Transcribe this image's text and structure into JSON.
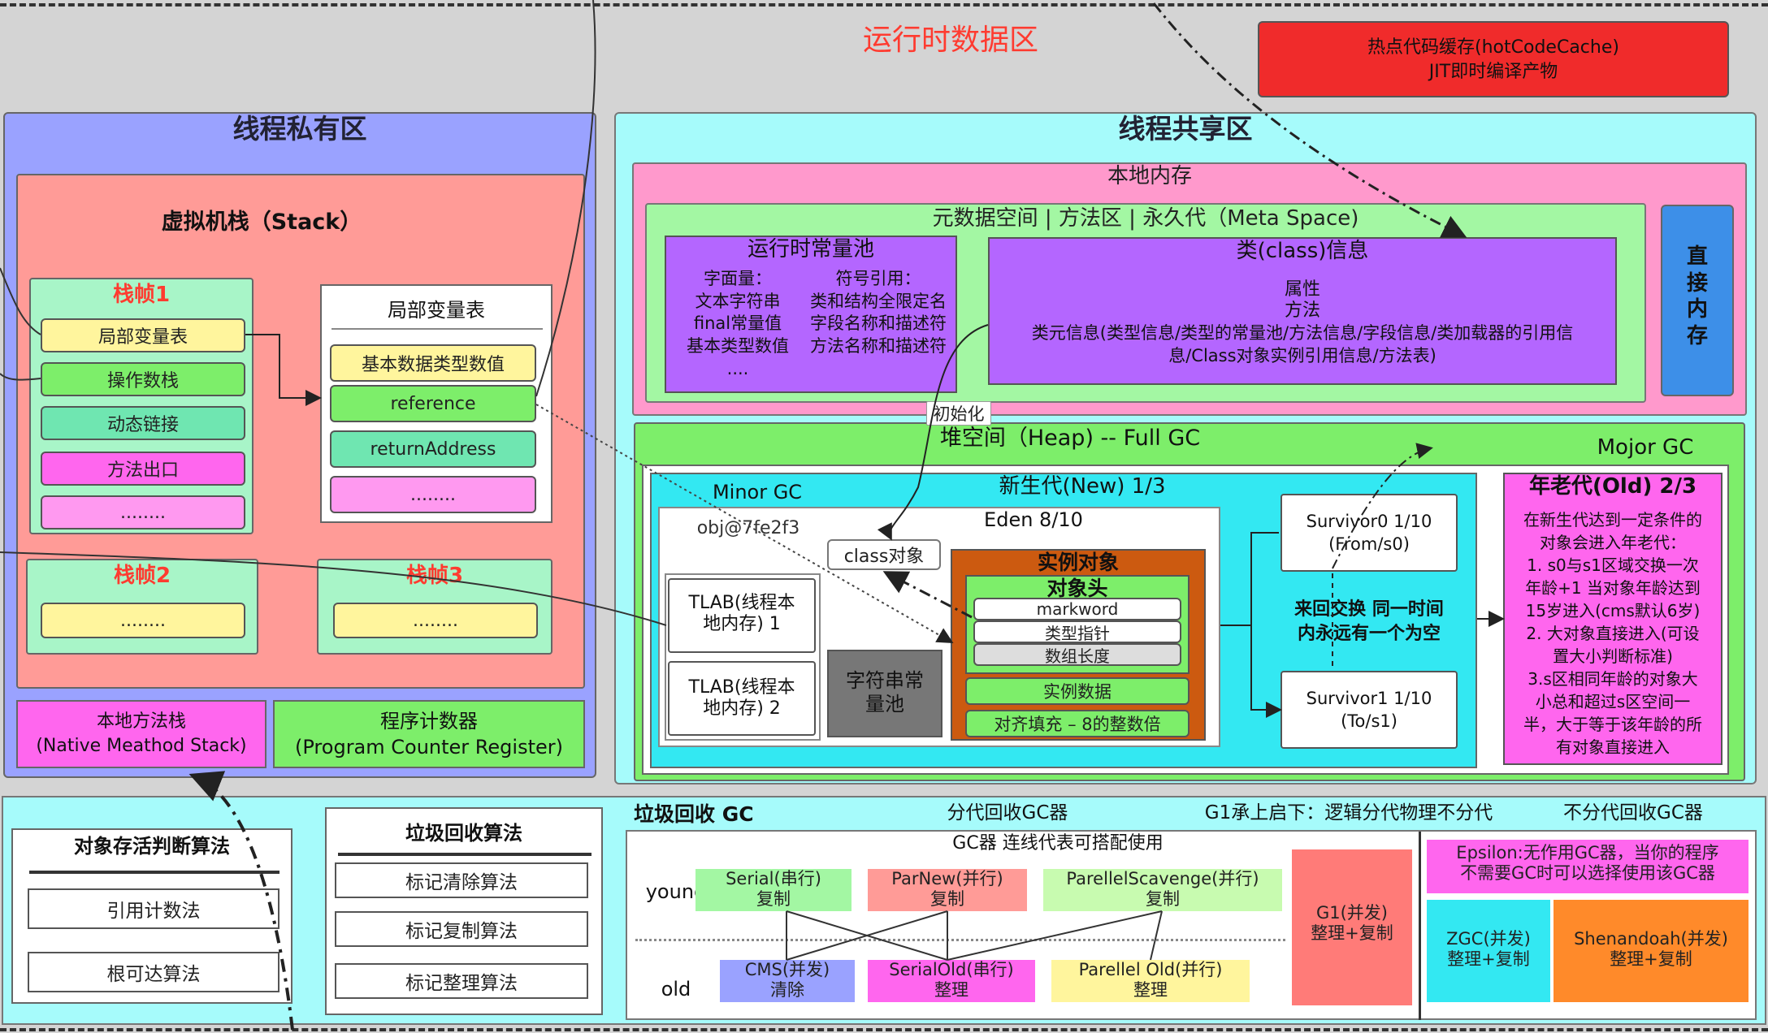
{
  "title": "运行时数据区",
  "hot_cache": {
    "line1": "热点代码缓存(hotCodeCache)",
    "line2": "JIT即时编译产物"
  },
  "private": {
    "title": "线程私有区",
    "stack_title": "虚拟机栈（Stack）",
    "frame1": {
      "title": "栈帧1",
      "items": [
        "局部变量表",
        "操作数栈",
        "动态链接",
        "方法出口",
        "........"
      ]
    },
    "frame2": {
      "title": "栈帧2",
      "item": "........"
    },
    "frame3": {
      "title": "栈帧3",
      "item": "........"
    },
    "locals": {
      "title": "局部变量表",
      "items": [
        "基本数据类型数值",
        "reference",
        "returnAddress",
        "........"
      ]
    },
    "native": {
      "line1": "本地方法栈",
      "line2": "(Native Meathod Stack)"
    },
    "pc": {
      "line1": "程序计数器",
      "line2": "(Program Counter Register)"
    }
  },
  "shared": {
    "title": "线程共享区",
    "native_mem": "本地内存",
    "direct_mem": "直\n接\n内\n存",
    "meta_title": "元数据空间 | 方法区 | 永久代（Meta Space)",
    "rt_pool": {
      "title": "运行时常量池",
      "left": "字面量：\n文本字符串\nfinal常量值\n基本类型数值\n....",
      "right": "符号引用：\n类和结构全限定名\n字段名称和描述符\n方法名称和描述符"
    },
    "class_info": {
      "title": "类(class)信息",
      "line1": "属性",
      "line2": "方法",
      "line3": "类元信息(类型信息/类型的常量池/方法信息/字段信息/类加载器的引用信",
      "line4": "息/Class对象实例引用信息/方法表)"
    },
    "init_label": "初始化",
    "heap_title": "堆空间（Heap)   -- Full GC",
    "major_gc": "Mojor GC",
    "minor_gc": "Minor GC",
    "new_gen": "新生代(New)  1/3",
    "eden": "Eden  8/10",
    "obj_ref": "obj@7fe2f3",
    "class_obj": "class对象",
    "tlab1": "TLAB(线程本\n地内存) 1",
    "tlab2": "TLAB(线程本\n地内存) 2",
    "string_pool": "字符串常\n量池",
    "instance": {
      "title": "实例对象",
      "header": "对象头",
      "markword": "markword",
      "type_ptr": "类型指针",
      "array_len": "数组长度",
      "data": "实例数据",
      "padding": "对齐填充 – 8的整数倍"
    },
    "s0": "Survivor0    1/10\n(From/s0)",
    "s1": "Survivor1    1/10\n(To/s1)",
    "swap": "来回交换  同一时间\n内永远有一个为空",
    "old": {
      "title": "年老代(Old)  2/3",
      "desc": "在新生代达到一定条件的\n对象会进入年老代：\n1. s0与s1区域交换一次\n年龄+1 当对象年龄达到\n15岁进入(cms默认6岁)\n2. 大对象直接进入(可设\n置大小判断标准)\n3.s区相同年龄的对象大\n小总和超过s区空间一\n半，大于等于该年龄的所\n有对象直接进入"
    }
  },
  "bottom": {
    "judge": {
      "title": "对象存活判断算法",
      "items": [
        "引用计数法",
        "根可达算法"
      ]
    },
    "algo": {
      "title": "垃圾回收算法",
      "items": [
        "标记清除算法",
        "标记复制算法",
        "标记整理算法"
      ]
    },
    "gc_title": "垃圾回收 GC",
    "gen_title": "分代回收GC器",
    "g1_title": "G1承上启下：逻辑分代物理不分代",
    "nogen_title": "不分代回收GC器",
    "combo_title": "GC器  连线代表可搭配使用",
    "young": "young",
    "old": "old",
    "serial": "Serial(串行)\n复制",
    "parnew": "ParNew(并行)\n复制",
    "pscav": "ParellelScavenge(并行)\n复制",
    "cms": "CMS(并发)\n清除",
    "serialold": "SerialOld(串行)\n整理",
    "parold": "Parellel Old(并行)\n整理",
    "g1": "G1(并发)\n整理+复制",
    "epsilon": "Epsilon:无作用GC器，当你的程序\n不需要GC时可以选择使用该GC器",
    "zgc": "ZGC(并发)\n整理+复制",
    "shen": "Shenandoah(并发)\n整理+复制"
  },
  "colors": {
    "bg": "#d4d4d4",
    "red_title": "#ff3b30",
    "private": "#9aa2ff",
    "stack": "#ff9b97",
    "frame": "#a8f5c8",
    "yellow": "#fff59d",
    "green": "#7dee6a",
    "teal": "#6fe6b1",
    "magenta": "#ff66ee",
    "shared": "#a6fbfb",
    "native": "#ff99cc",
    "meta": "#a3f7a3",
    "purple": "#b466ff",
    "cyan": "#33e8f2",
    "orange": "#cc5a10",
    "blue": "#3d8fe8"
  }
}
